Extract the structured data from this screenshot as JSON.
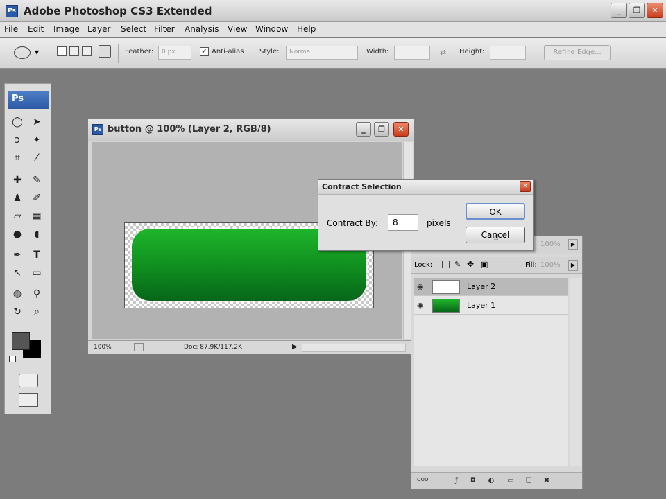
{
  "app": {
    "title": "Adobe Photoshop CS3 Extended",
    "icon": "Ps"
  },
  "window_controls": {
    "minimize": "_",
    "restore": "❐",
    "close": "✕"
  },
  "menu": [
    "File",
    "Edit",
    "Image",
    "Layer",
    "Select",
    "Filter",
    "Analysis",
    "View",
    "Window",
    "Help"
  ],
  "options": {
    "feather_label": "Feather:",
    "feather_value": "0 px",
    "antialias_label": "Anti-alias",
    "antialias_checked": true,
    "style_label": "Style:",
    "style_value": "Normal",
    "width_label": "Width:",
    "height_label": "Height:",
    "refine_label": "Refine Edge..."
  },
  "toolbox": {
    "logo": "Ps",
    "tools": [
      "marquee-tool",
      "move-tool",
      "lasso-tool",
      "magic-wand-tool",
      "crop-tool",
      "slice-tool",
      "healing-brush-tool",
      "brush-tool",
      "clone-stamp-tool",
      "history-brush-tool",
      "eraser-tool",
      "gradient-tool",
      "blur-tool",
      "dodge-tool",
      "pen-tool",
      "type-tool",
      "path-selection-tool",
      "shape-tool",
      "3d-rotate-tool",
      "eyedropper-tool",
      "3d-orbit-tool",
      "zoom-tool"
    ],
    "foreground_color": "#555555",
    "background_color": "#000000"
  },
  "document": {
    "title": "button @ 100% (Layer 2, RGB/8)",
    "zoom": "100%",
    "doc_info": "Doc: 87.9K/117.2K",
    "button_color_top": "#1fb52c",
    "button_color_bottom": "#07661a"
  },
  "dialog": {
    "title": "Contract Selection",
    "label": "Contract By:",
    "value": "8",
    "unit": "pixels",
    "ok": "OK",
    "cancel": "Cancel"
  },
  "layers": {
    "opacity_value": "100%",
    "lock_label": "Lock:",
    "fill_label": "Fill:",
    "fill_value": "100%",
    "items": [
      {
        "name": "Layer 2",
        "selected": true
      },
      {
        "name": "Layer 1",
        "selected": false
      }
    ],
    "footer_link": "ooo"
  }
}
